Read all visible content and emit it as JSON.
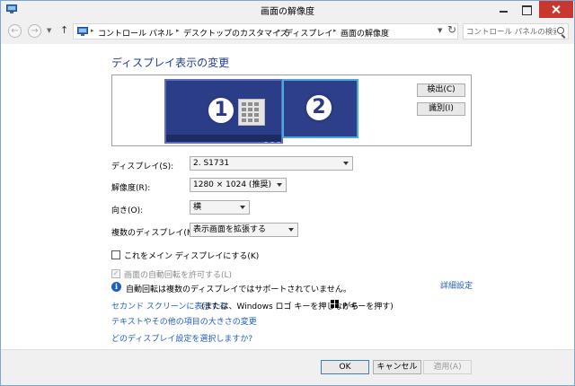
{
  "window": {
    "title": "画面の解像度"
  },
  "nav": {
    "breadcrumbs": [
      "コントロール パネル",
      "デスクトップのカスタマイズ",
      "ディスプレイ",
      "画面の解像度"
    ],
    "search_placeholder": "コントロール パネルの検索"
  },
  "page": {
    "heading": "ディスプレイ表示の変更",
    "monitors": [
      {
        "number": "1"
      },
      {
        "number": "2"
      }
    ],
    "detect_label": "検出(C)",
    "identify_label": "識別(I)"
  },
  "settings": {
    "display_label": "ディスプレイ(S):",
    "display_value": "2. S1731",
    "resolution_label": "解像度(R):",
    "resolution_value": "1280 × 1024 (推奨)",
    "orientation_label": "向き(O):",
    "orientation_value": "横",
    "multi_label": "複数のディスプレイ(M):",
    "multi_value": "表示画面を拡張する"
  },
  "options": {
    "main_display_label": "これをメイン ディスプレイにする(K)",
    "auto_rotate_label": "画面の自動回転を許可する(L)",
    "info_text": "自動回転は複数のディスプレイではサポートされていません。",
    "advanced_link": "詳細設定"
  },
  "links": {
    "second_screen_link": "セカンド スクリーンに表示する",
    "second_screen_rest_a": "(または、Windows ロゴ キーを押しながら",
    "second_screen_rest_b": "P キーを押す)",
    "text_size_link": "テキストやその他の項目の大きさの変更",
    "which_settings_link": "どのディスプレイ設定を選択しますか?"
  },
  "footer": {
    "ok_label": "OK",
    "cancel_label": "キャンセル",
    "apply_label": "適用(A)"
  },
  "colors": {
    "link": "#1f5fbf",
    "heading": "#1e3d8f",
    "close_button": "#c7372f",
    "monitor_fill": "#2c3d88",
    "selected_monitor_border": "#48a8e0"
  }
}
